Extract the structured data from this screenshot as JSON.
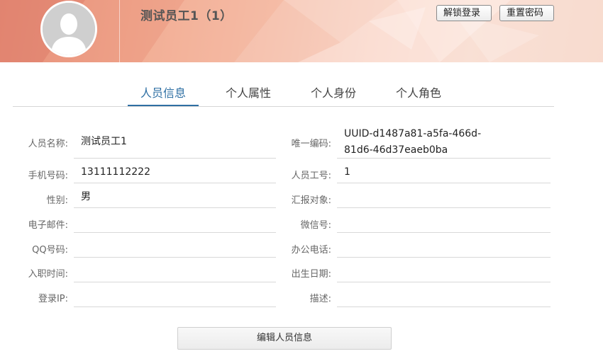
{
  "header": {
    "title": "测试员工1（1）",
    "unlock_login_label": "解锁登录",
    "reset_password_label": "重置密码"
  },
  "tabs": [
    {
      "label": "人员信息",
      "active": true
    },
    {
      "label": "个人属性",
      "active": false
    },
    {
      "label": "个人身份",
      "active": false
    },
    {
      "label": "个人角色",
      "active": false
    }
  ],
  "form": {
    "left": [
      {
        "label": "人员名称:",
        "value": "测试员工1"
      },
      {
        "label": "手机号码:",
        "value": "13111112222"
      },
      {
        "label": "性别:",
        "value": "男"
      },
      {
        "label": "电子邮件:",
        "value": ""
      },
      {
        "label": "QQ号码:",
        "value": ""
      },
      {
        "label": "入职时间:",
        "value": ""
      },
      {
        "label": "登录IP:",
        "value": ""
      }
    ],
    "right": [
      {
        "label": "唯一编码:",
        "value_line1": "UUID-d1487a81-a5fa-466d-",
        "value_line2": "81d6-46d37eaeb0ba"
      },
      {
        "label": "人员工号:",
        "value": "1"
      },
      {
        "label": "汇报对象:",
        "value": ""
      },
      {
        "label": "微信号:",
        "value": ""
      },
      {
        "label": "办公电话:",
        "value": ""
      },
      {
        "label": "出生日期:",
        "value": ""
      },
      {
        "label": "描述:",
        "value": ""
      }
    ]
  },
  "actions": {
    "edit_label": "编辑人员信息"
  },
  "colors": {
    "accent": "#2e6fa3",
    "header_start": "#e48c78",
    "header_end": "#f8ddd2"
  },
  "icons": {
    "avatar": "default-user-avatar-icon"
  }
}
